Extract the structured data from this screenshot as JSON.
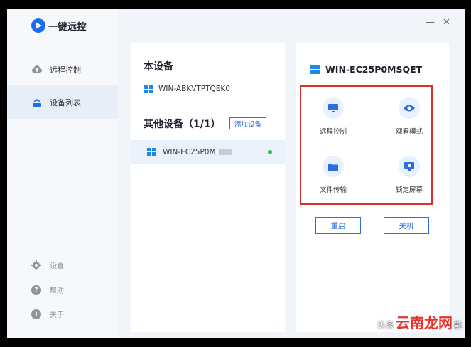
{
  "app": {
    "name": "一键远控"
  },
  "window_controls": {
    "minimize": "—",
    "close": "✕"
  },
  "sidebar": {
    "items": [
      {
        "label": "远程控制",
        "icon": "cloud-upload-icon"
      },
      {
        "label": "设备列表",
        "icon": "devices-icon"
      }
    ],
    "bottom": [
      {
        "label": "设置",
        "icon": "gear-icon"
      },
      {
        "label": "帮助",
        "icon": "help-icon"
      },
      {
        "label": "关于",
        "icon": "info-icon"
      }
    ]
  },
  "local_device": {
    "title": "本设备",
    "name": "WIN-ABKVTPTQEK0"
  },
  "other_devices": {
    "title": "其他设备（1/1）",
    "add_button": "添加设备",
    "items": [
      {
        "name": "WIN-EC25P0M",
        "status": "online"
      }
    ]
  },
  "selected_device": {
    "name": "WIN-EC25P0MSQET",
    "actions": [
      {
        "label": "远程控制",
        "icon": "monitor-icon"
      },
      {
        "label": "观看模式",
        "icon": "eye-icon"
      },
      {
        "label": "文件传输",
        "icon": "folder-icon"
      },
      {
        "label": "锁定屏幕",
        "icon": "lock-screen-icon"
      }
    ],
    "buttons": {
      "restart": "重启",
      "shutdown": "关机"
    }
  },
  "watermark": {
    "prefix": "头条",
    "brand": "云南龙网",
    "suffix": "能"
  },
  "colors": {
    "accent": "#2a6fdc",
    "highlight_border": "#d9302a",
    "online": "#2ec25b"
  }
}
